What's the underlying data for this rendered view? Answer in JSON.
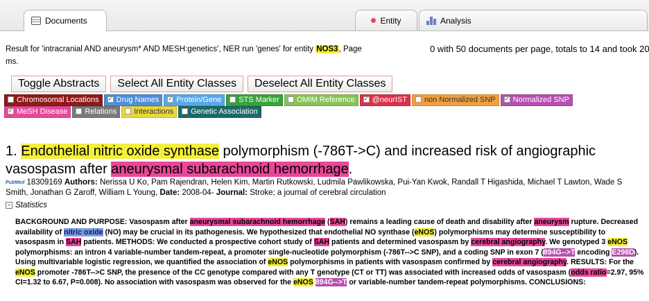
{
  "tabs": {
    "documents": "Documents",
    "entity": "Entity",
    "analysis": "Analysis"
  },
  "result": {
    "prefix": "Result for 'intracranial AND aneurysm* AND MESH:genetics', NER run 'genes' for entity ",
    "entity": "NOS3",
    "suffix": ", Page",
    "right": "0 with 50 documents per page, totals to 14 and took 20",
    "tail": "ms."
  },
  "buttons": {
    "toggle": "Toggle Abstracts",
    "select_all": "Select All Entity Classes",
    "deselect_all": "Deselect All Entity Classes"
  },
  "legend": {
    "row1": [
      {
        "label": "Chromosomal Locations",
        "color": "#8e1a1a",
        "checked": false
      },
      {
        "label": "Drug Names",
        "color": "#4f8ed8",
        "checked": true
      },
      {
        "label": "Protein/Gene",
        "color": "#58a8e8",
        "checked": true
      },
      {
        "label": "STS Marker",
        "color": "#3aa23a",
        "checked": false
      },
      {
        "label": "OMIM Reference",
        "color": "#88c25a",
        "checked": false
      },
      {
        "label": "@neurIST",
        "color": "#d8324a",
        "checked": true
      },
      {
        "label": "non Normalized SNP",
        "color": "#f0a040",
        "checked": false
      },
      {
        "label": "Normalized SNP",
        "color": "#b64fb0",
        "checked": true
      }
    ],
    "row2": [
      {
        "label": "MeSH Disease",
        "color": "#e8479a",
        "checked": true
      },
      {
        "label": "Relations",
        "color": "#7a7a7a",
        "checked": false
      },
      {
        "label": "Interactions",
        "color": "#e8d83a",
        "checked": false
      },
      {
        "label": "Genetic Association",
        "color": "#1c6a6a",
        "checked": false
      }
    ]
  },
  "article": {
    "number": "1.",
    "title_hl1": "Endothelial nitric oxide synthase",
    "title_mid": " polymorphism (-786T->C) and increased risk of angiographic vasospasm after ",
    "title_hl2": "aneurysmal subarachnoid hemorrhage",
    "title_end": ".",
    "pubmed": "PubMed",
    "pmid": "18309169",
    "authors_label": "Authors:",
    "authors": "Nerissa U Ko, Pam Rajendran, Helen Kim, Martin Rutkowski, Ludmila Pawlikowska, Pui-Yan Kwok, Randall T Higashida, Michael T Lawton, Wade S Smith, Jonathan G Zaroff, William L Young,",
    "date_label": "Date:",
    "date": "2008-04-",
    "journal_label": "Journal:",
    "journal": "Stroke; a journal of cerebral circulation",
    "stats_label": "Statistics"
  },
  "abstract": [
    {
      "t": "BACKGROUND AND PURPOSE: Vasospasm after "
    },
    {
      "t": "aneurysmal subarachnoid hemorrhage",
      "c": "m"
    },
    {
      "t": " ("
    },
    {
      "t": "SAH",
      "c": "m"
    },
    {
      "t": ") remains a leading cause of death and disability after "
    },
    {
      "t": "aneurysm",
      "c": "m"
    },
    {
      "t": " rupture. Decreased availability of "
    },
    {
      "t": "nitric oxide",
      "c": "b"
    },
    {
      "t": " (NO) may be crucial in its pathogenesis. We hypothesized that endothelial NO synthase ("
    },
    {
      "t": "eNOS",
      "c": "y"
    },
    {
      "t": ") polymorphisms may determine susceptibility to vasospasm in "
    },
    {
      "t": "SAH",
      "c": "m"
    },
    {
      "t": " patients. METHODS: We conducted a prospective cohort study of "
    },
    {
      "t": "SAH",
      "c": "m"
    },
    {
      "t": " patients and determined vasospasm by "
    },
    {
      "t": "cerebral angiography",
      "c": "m"
    },
    {
      "t": ". We genotyped 3 "
    },
    {
      "t": "eNOS",
      "c": "y"
    },
    {
      "t": " polymorphisms: an intron 4 variable-number tandem-repeat, a promoter single-nucleotide polymorphism (-786T-->C SNP), and a coding SNP in exon 7 ("
    },
    {
      "t": "894G-->T",
      "c": "p"
    },
    {
      "t": " encoding "
    },
    {
      "t": "E298D",
      "c": "p"
    },
    {
      "t": "). Using multivariable logistic regression, we quantified the association of "
    },
    {
      "t": "eNOS",
      "c": "y"
    },
    {
      "t": " polymorphisms in patients with vasospasm confirmed by "
    },
    {
      "t": "cerebral angiography",
      "c": "m"
    },
    {
      "t": ". RESULTS: For the "
    },
    {
      "t": "eNOS",
      "c": "y"
    },
    {
      "t": " promoter -786T-->C SNP, the presence of the CC genotype compared with any T genotype (CT or TT) was associated with increased odds of vasospasm ("
    },
    {
      "t": "odds ratio",
      "c": "m"
    },
    {
      "t": "=2.97, 95% CI=1.32 to 6.67, P=0.008). No association with vasospasm was observed for the "
    },
    {
      "t": "eNOS",
      "c": "y"
    },
    {
      "t": " "
    },
    {
      "t": "894G-->T",
      "c": "p"
    },
    {
      "t": " or variable-number tandem-repeat polymorphisms. CONCLUSIONS:"
    }
  ]
}
